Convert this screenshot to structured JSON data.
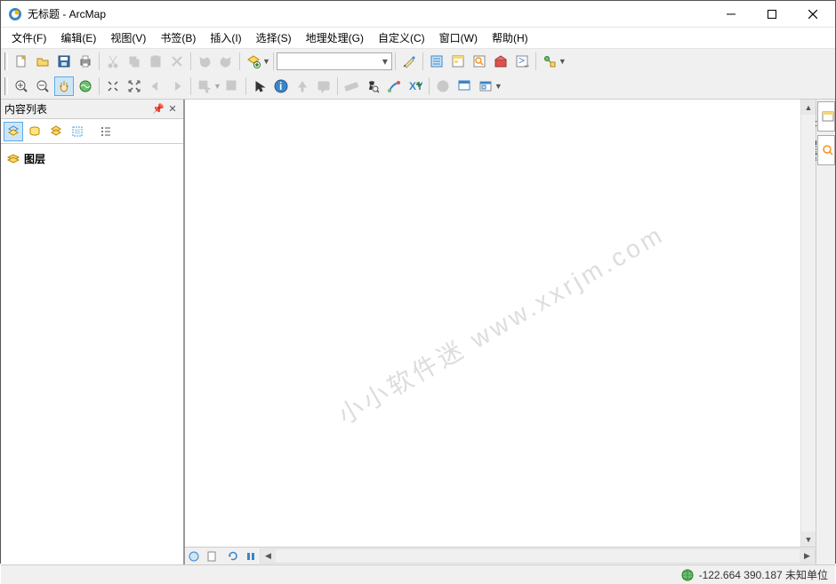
{
  "title": "无标题 - ArcMap",
  "menus": [
    "文件(F)",
    "编辑(E)",
    "视图(V)",
    "书签(B)",
    "插入(I)",
    "选择(S)",
    "地理处理(G)",
    "自定义(C)",
    "窗口(W)",
    "帮助(H)"
  ],
  "toc": {
    "title": "内容列表",
    "root": "图层"
  },
  "sideTabs": [
    "目录",
    "搜索"
  ],
  "watermark": "小小软件迷   www.xxrjm.com",
  "status": {
    "coords": "-122.664 390.187 未知单位"
  }
}
